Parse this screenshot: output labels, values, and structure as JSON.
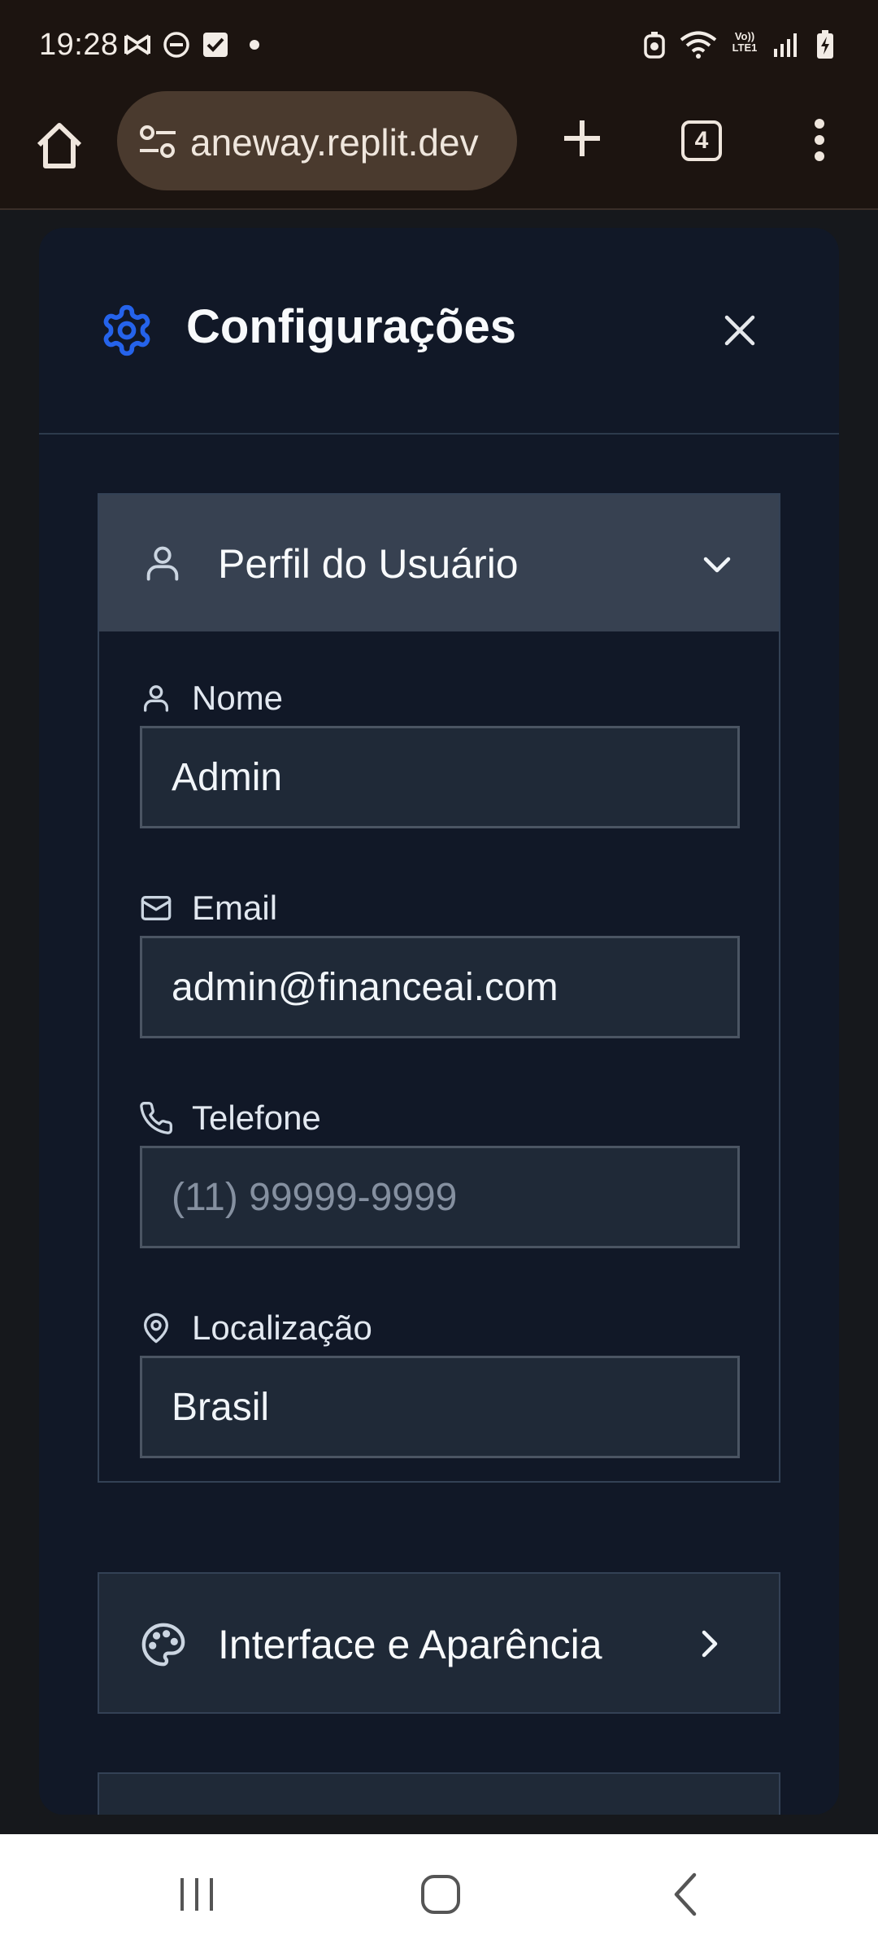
{
  "status_bar": {
    "time": "19:28",
    "icons_left": [
      "capcut-icon",
      "do-not-disturb-icon",
      "checkbox-icon",
      "dot-icon"
    ],
    "icons_right": [
      "alarm-icon",
      "wifi-icon",
      "volte-icon",
      "signal-icon",
      "battery-charging-icon"
    ],
    "volte_text": "Vo)) LTE1"
  },
  "browser": {
    "url": "aneway.replit.dev",
    "tab_count": "4"
  },
  "panel": {
    "title": "Configurações",
    "profile": {
      "title": "Perfil do Usuário",
      "fields": {
        "name": {
          "label": "Nome",
          "value": "Admin"
        },
        "email": {
          "label": "Email",
          "value": "admin@financeai.com"
        },
        "phone": {
          "label": "Telefone",
          "placeholder": "(11) 99999-9999"
        },
        "location": {
          "label": "Localização",
          "value": "Brasil"
        }
      }
    },
    "interface": {
      "title": "Interface e Aparência"
    }
  },
  "colors": {
    "panel_bg": "#111827",
    "accent_blue": "#2563eb",
    "section_header_bg": "#374151",
    "input_bg": "#1f2937",
    "browser_chrome": "#1c1410"
  }
}
